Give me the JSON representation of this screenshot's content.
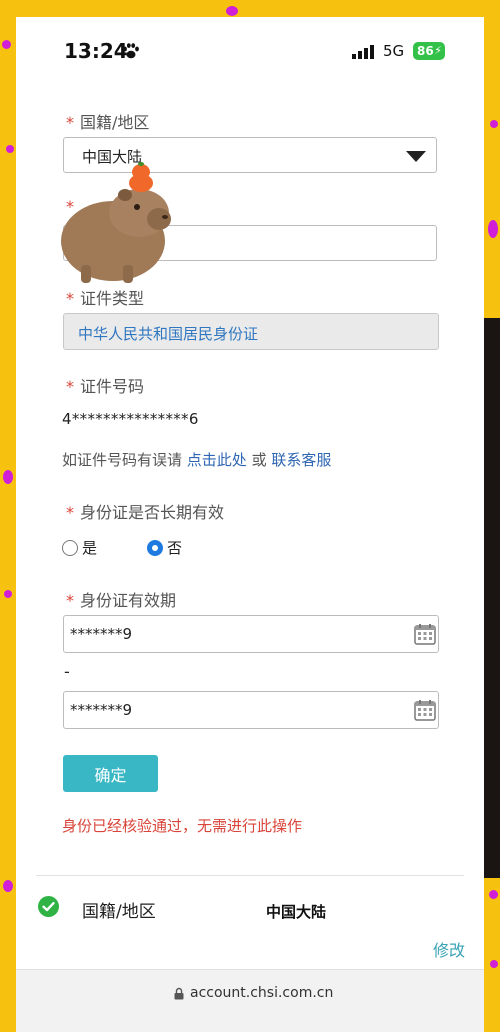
{
  "status_bar": {
    "time": "13:24",
    "network": "5G",
    "battery": "86"
  },
  "form": {
    "nationality": {
      "required_mark": "*",
      "label": "国籍/地区",
      "selected": "中国大陆"
    },
    "name": {
      "required_mark": "*",
      "label": "",
      "value": ""
    },
    "id_type": {
      "required_mark": "*",
      "label": "证件类型",
      "value": "中华人民共和国居民身份证"
    },
    "id_number": {
      "required_mark": "*",
      "label": "证件号码",
      "value": "4***************6"
    },
    "hint": {
      "text": "如证件号码有误请",
      "link1": "点击此处",
      "or": "或",
      "link2": "联系客服"
    },
    "long_term": {
      "required_mark": "*",
      "label": "身份证是否长期有效",
      "options": [
        {
          "label": "是",
          "selected": false
        },
        {
          "label": "否",
          "selected": true
        }
      ]
    },
    "validity": {
      "required_mark": "*",
      "label": "身份证有效期",
      "start": "*******9",
      "separator": "-",
      "end": "*******9"
    },
    "confirm_label": "确定",
    "verified_message": "身份已经核验通过，无需进行此操作"
  },
  "summary": {
    "label": "国籍/地区",
    "value": "中国大陆",
    "edit_label": "修改"
  },
  "browser": {
    "url": "account.chsi.com.cn"
  },
  "colors": {
    "accent": "#39b7c4",
    "required": "#d9453a",
    "link": "#2f66b3",
    "background": "#f7c20f",
    "dots": "#d11fd7"
  },
  "icons": [
    "paw-icon",
    "signal-icon",
    "battery-icon",
    "caret-icon",
    "calendar-icon",
    "check-icon",
    "lock-icon",
    "capybara-sticker"
  ]
}
